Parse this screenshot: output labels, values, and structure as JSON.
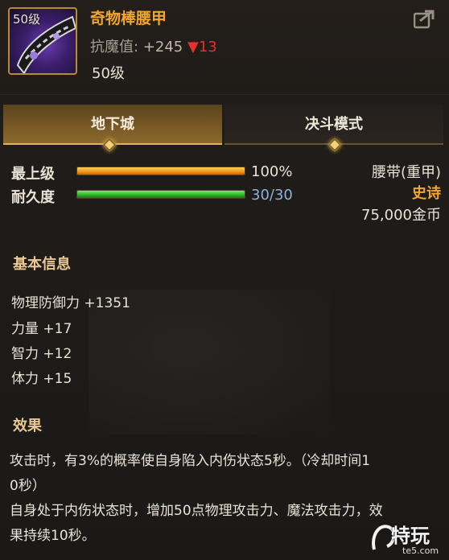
{
  "item": {
    "icon_level": "50级",
    "name": "奇物棒腰甲",
    "stat_label": "抗魔值:",
    "stat_plus": "+245",
    "stat_diff_icon": "▼",
    "stat_diff": "13",
    "required_level": "50级"
  },
  "tabs": [
    {
      "label": "地下城",
      "active": true
    },
    {
      "label": "决斗模式",
      "active": false
    }
  ],
  "bars": {
    "grade": {
      "label": "最上级",
      "value": "100%",
      "fraction": 1.0
    },
    "durability": {
      "label": "耐久度",
      "value": "30/30",
      "fraction": 1.0
    }
  },
  "info": {
    "type": "腰带(重甲)",
    "rarity": "史诗",
    "price": "75,000金币"
  },
  "basic": {
    "title": "基本信息",
    "stats": [
      "物理防御力 +1351",
      "力量 +17",
      "智力 +12",
      "体力 +15"
    ]
  },
  "effect": {
    "title": "效果",
    "line1": "攻击时，有3%的概率使自身陷入内伤状态5秒。（冷却时间1",
    "line2": "0秒）",
    "line3": "自身处于内伤状态时，增加50点物理攻击力、魔法攻击力，效",
    "line4": "果持续10秒。"
  },
  "watermark": {
    "text": "特玩",
    "sub": "te5.com"
  },
  "colors": {
    "accent": "#f0a62f",
    "epic": "#f0a62f",
    "down": "#e2322b",
    "section": "#e9c892"
  }
}
